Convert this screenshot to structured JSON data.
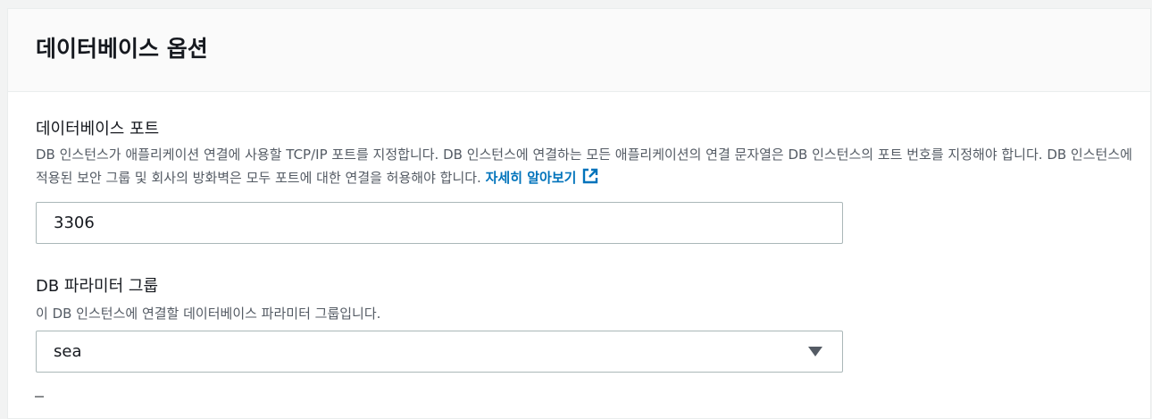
{
  "panel": {
    "title": "데이터베이스 옵션"
  },
  "port_field": {
    "label": "데이터베이스 포트",
    "description": "DB 인스턴스가 애플리케이션 연결에 사용할 TCP/IP 포트를 지정합니다. DB 인스턴스에 연결하는 모든 애플리케이션의 연결 문자열은 DB 인스턴스의 포트 번호를 지정해야 합니다. DB 인스턴스에 적용된 보안 그룹 및 회사의 방화벽은 모두 포트에 대한 연결을 허용해야 합니다.",
    "link_text": "자세히 알아보기",
    "value": "3306"
  },
  "param_group_field": {
    "label": "DB 파라미터 그룹",
    "description": "이 DB 인스턴스에 연결할 데이터베이스 파라미터 그룹입니다.",
    "selected": "sea"
  },
  "icons": {
    "external_link": "external-link-icon",
    "dropdown": "caret-down-icon"
  },
  "colors": {
    "link": "#0073bb",
    "label": "#16191f",
    "description": "#545b64",
    "border": "#aab7b8"
  }
}
